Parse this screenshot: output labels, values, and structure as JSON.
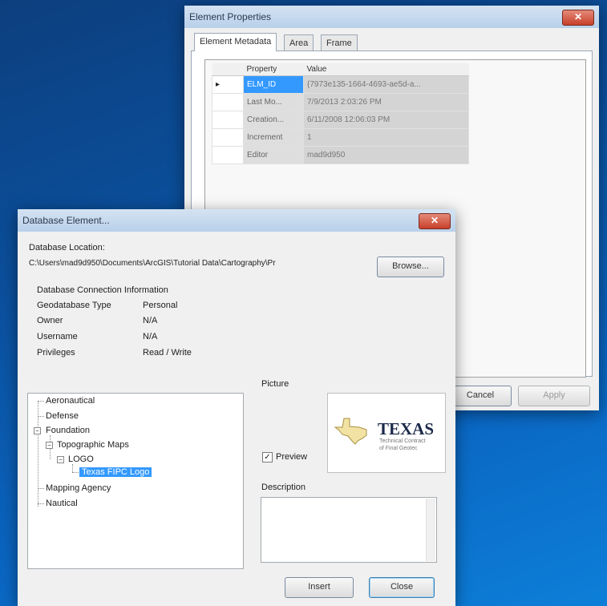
{
  "props_window": {
    "title": "Element Properties",
    "close_glyph": "✕",
    "tabs": [
      "Element Metadata",
      "Area",
      "Frame"
    ],
    "grid": {
      "headers": [
        "Property",
        "Value"
      ],
      "current_row_marker": "▸",
      "rows": [
        {
          "property": "ELM_ID",
          "value": "{7973e135-1664-4693-ae5d-a..."
        },
        {
          "property": "Last Mo...",
          "value": "7/9/2013 2:03:26 PM"
        },
        {
          "property": "Creation...",
          "value": "6/11/2008 12:06:03 PM"
        },
        {
          "property": "Increment",
          "value": "1"
        },
        {
          "property": "Editor",
          "value": "mad9d950"
        }
      ]
    },
    "cancel_label": "Cancel",
    "apply_label": "Apply"
  },
  "db_window": {
    "title": "Database Element...",
    "close_glyph": "✕",
    "location_label": "Database Location:",
    "location_value": "C:\\Users\\mad9d950\\Documents\\ArcGIS\\Tutorial Data\\Cartography\\Pr",
    "browse_label": "Browse...",
    "conn_title": "Database Connection Information",
    "conn_rows": [
      {
        "label": "Geodatabase Type",
        "value": "Personal"
      },
      {
        "label": "Owner",
        "value": "N/A"
      },
      {
        "label": "Username",
        "value": "N/A"
      },
      {
        "label": "Privileges",
        "value": "Read / Write"
      }
    ],
    "tree": {
      "aeronautical": "Aeronautical",
      "defense": "Defense",
      "foundation": "Foundation",
      "topographic": "Topographic Maps",
      "logo": "LOGO",
      "texas_logo": "Texas FIPC Logo",
      "mapping_agency": "Mapping Agency",
      "nautical": "Nautical",
      "minus": "−"
    },
    "picture_label": "Picture",
    "preview_label": "Preview",
    "preview_checked": "✓",
    "texas_text": "TEXAS",
    "texas_sub1": "Technical Contract",
    "texas_sub2": "of Final Geotec",
    "description_label": "Description",
    "insert_label": "Insert",
    "close_label": "Close"
  }
}
